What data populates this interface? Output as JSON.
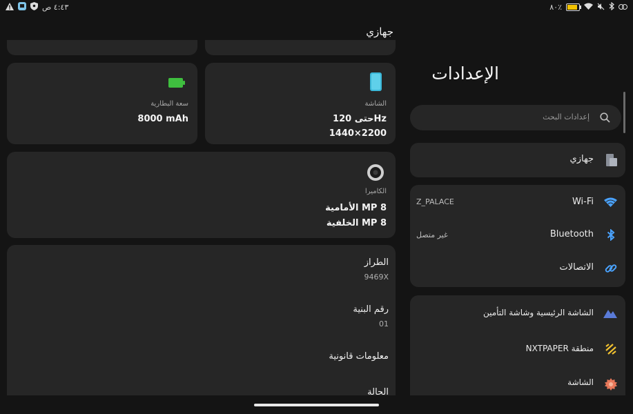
{
  "status_bar": {
    "time": "٤:٤٣ ص",
    "battery_level": 0.85,
    "battery_percent": "٨٠٪"
  },
  "left": {
    "title": "جهازي",
    "battery_card": {
      "label": "سعة البطارية",
      "value": "8000 mAh"
    },
    "screen_card": {
      "label": "الشاشة",
      "line1": "حتى 120Hz",
      "line2": "1440×2200"
    },
    "camera_card": {
      "label": "الكاميرا",
      "front": "الأمامية  MP 8",
      "back": "الخلفية  MP 8"
    },
    "info": [
      {
        "label": "الطراز",
        "value": "9469X"
      },
      {
        "label": "رقم البنية",
        "value": "01"
      },
      {
        "label": "معلومات قانونية",
        "value": ""
      },
      {
        "label": "الحالة",
        "value": ""
      }
    ]
  },
  "right": {
    "title": "الإعدادات",
    "search_placeholder": "إعدادات البحث",
    "my_device": "جهازي",
    "connections": [
      {
        "label": "Wi-Fi",
        "value": "Z_PALACE"
      },
      {
        "label": "Bluetooth",
        "value": "غير متصل"
      },
      {
        "label": "الاتصالات",
        "value": ""
      }
    ],
    "display": [
      {
        "label": "الشاشة الرئيسية وشاشة التأمين"
      },
      {
        "label": "منطقة NXTPAPER"
      },
      {
        "label": "الشاشة"
      }
    ]
  },
  "colors": {
    "background": "#141414",
    "card": "#262626",
    "wifi_blue": "#4aa3ff",
    "battery_green": "#3fbf3f",
    "accent_blue": "#5a7bd8"
  }
}
